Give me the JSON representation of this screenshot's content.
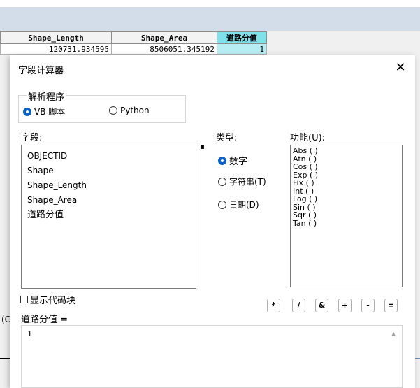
{
  "table": {
    "headers": [
      "Shape_Length",
      "Shape_Area",
      "道路分值"
    ],
    "row": [
      "120731.934595",
      "8506051.345192",
      "1"
    ]
  },
  "background": {
    "left_fragment": "(C"
  },
  "dialog": {
    "title": "字段计算器",
    "close_glyph": "✕",
    "parser": {
      "legend": "解析程序",
      "options": [
        "VB 脚本",
        "Python"
      ],
      "selected": "VB 脚本"
    },
    "fields_label": "字段:",
    "fields": [
      "OBJECTID",
      "Shape",
      "Shape_Length",
      "Shape_Area",
      "道路分值"
    ],
    "field_scroll_mark": "▪",
    "type_label": "类型:",
    "types": [
      "数字",
      "字符串(T)",
      "日期(D)"
    ],
    "selected_type": "数字",
    "functions_label": "功能(U):",
    "functions": [
      "Abs ( )",
      "Atn ( )",
      "Cos ( )",
      "Exp ( )",
      "Fix ( )",
      "Int ( )",
      "Log ( )",
      "Sin ( )",
      "Sqr ( )",
      "Tan ( )"
    ],
    "show_codeblock_label": "显示代码块",
    "operators": [
      "*",
      "/",
      "&",
      "+",
      "-",
      "="
    ],
    "expression_label": "道路分值 =",
    "expression": "1",
    "scroll_up_glyph": "▲"
  },
  "colors": {
    "selected_column_header": "#7fe2ea",
    "radio_selected": "#0a5fc8",
    "top_band": "#d3dde9"
  }
}
